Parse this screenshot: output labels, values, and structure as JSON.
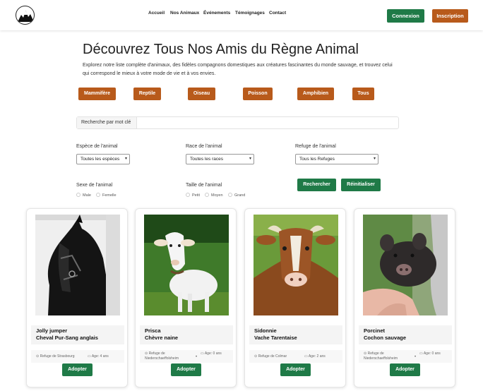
{
  "header": {
    "nav": [
      "Accueil",
      "Nos Animaux",
      "Événements",
      "Témoignages",
      "Contact"
    ],
    "login_label": "Connexion",
    "signup_label": "Inscription"
  },
  "hero": {
    "title": "Découvrez Tous Nos Amis du Règne Animal",
    "intro": "Explorez notre liste complète d'animaux, des fidèles compagnons domestiques aux créatures fascinantes du monde sauvage, et trouvez celui qui correspond le mieux à votre mode de vie et à vos envies."
  },
  "categories": [
    "Mammifère",
    "Reptile",
    "Oiseau",
    "Poisson",
    "Amphibien",
    "Tous"
  ],
  "search": {
    "label": "Recherche par mot clé"
  },
  "filters": {
    "species_label": "Espèce de l'animal",
    "species_value": "Toutes les espèces",
    "breed_label": "Race de l'animal",
    "breed_value": "Toutes les races",
    "refuge_label": "Refuge de l'animal",
    "refuge_value": "Tous les Refuges",
    "sex_label": "Sexe de l'animal",
    "sex_options": [
      "Male",
      "Femelle"
    ],
    "size_label": "Taille de l'animal",
    "size_options": [
      "Petit",
      "Moyen",
      "Grand"
    ],
    "search_label": "Rechercher",
    "reset_label": "Réinitialiser"
  },
  "animals": [
    {
      "name": "Jolly jumper",
      "breed": "Cheval Pur-Sang anglais",
      "refuge": "Refuge de Strasbourg",
      "age": "Age: 4 ans",
      "adopt": "Adopter"
    },
    {
      "name": "Prisca",
      "breed": "Chèvre naine",
      "refuge": "Refuge de Niederschaeffolsheim",
      "age": "Age: 0 ans",
      "adopt": "Adopter"
    },
    {
      "name": "Sidonnie",
      "breed": "Vache Tarentaise",
      "refuge": "Refuge de Colmar",
      "age": "Age: 2 ans",
      "adopt": "Adopter"
    },
    {
      "name": "Porcinet",
      "breed": "Cochon sauvage",
      "refuge": "Refuge de Niederschaeffolsheim",
      "age": "Age: 0 ans",
      "adopt": "Adopter"
    }
  ],
  "colors": {
    "green": "#1f7a47",
    "orange": "#b85a1b"
  }
}
